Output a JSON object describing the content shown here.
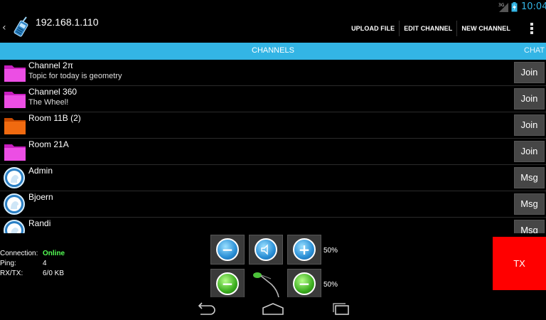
{
  "statusbar": {
    "time": "10:04",
    "signal_icon": "signal-3g-icon",
    "battery_icon": "battery-charging-icon",
    "accent": "#33b5e5"
  },
  "actionbar": {
    "title": "192.168.1.110",
    "app_icon": "walkie-talkie-icon",
    "actions": [
      "UPLOAD FILE",
      "EDIT CHANNEL",
      "NEW CHANNEL"
    ],
    "overflow_icon": "overflow-menu-icon"
  },
  "tabs": {
    "channels": "CHANNELS",
    "chat": "CHAT",
    "color": "#33b5e5"
  },
  "list": [
    {
      "type": "channel",
      "name": "Channel 2π",
      "topic": "Topic for today is geometry",
      "button": "Join",
      "icon": "folder-magenta-icon"
    },
    {
      "type": "channel",
      "name": "Channel 360",
      "topic": "The Wheel!",
      "button": "Join",
      "icon": "folder-magenta-icon"
    },
    {
      "type": "channel",
      "name": "Room 11B (2)",
      "topic": "",
      "button": "Join",
      "icon": "folder-orange-icon"
    },
    {
      "type": "channel",
      "name": "Room 21A",
      "topic": "",
      "button": "Join",
      "icon": "folder-magenta-icon"
    },
    {
      "type": "user",
      "name": "Admin",
      "topic": "",
      "button": "Msg",
      "icon": "user-head-icon"
    },
    {
      "type": "user",
      "name": "Bjoern",
      "topic": "",
      "button": "Msg",
      "icon": "user-head-icon"
    },
    {
      "type": "user",
      "name": "Randi",
      "topic": "",
      "button": "Msg",
      "icon": "user-head-icon"
    }
  ],
  "connection": {
    "connection_label": "Connection:",
    "connection_value": "Online",
    "ping_label": "Ping:",
    "ping_value": "4",
    "rxtx_label": "RX/TX:",
    "rxtx_value": "6/0 KB",
    "online_color": "#55ff55"
  },
  "controls": {
    "speaker_volume": "50%",
    "mic_gain": "50%",
    "volume_down_icon": "minus-icon",
    "speaker_icon": "speaker-icon",
    "volume_up_icon": "plus-icon",
    "mic_down_icon": "minus-icon",
    "mic_icon": "microphone-icon",
    "mic_up_icon": "minus-icon"
  },
  "tx": {
    "label": "TX",
    "color": "#ff0000"
  },
  "navbar": {
    "back_icon": "back-icon",
    "home_icon": "home-icon",
    "recents_icon": "recents-icon"
  }
}
